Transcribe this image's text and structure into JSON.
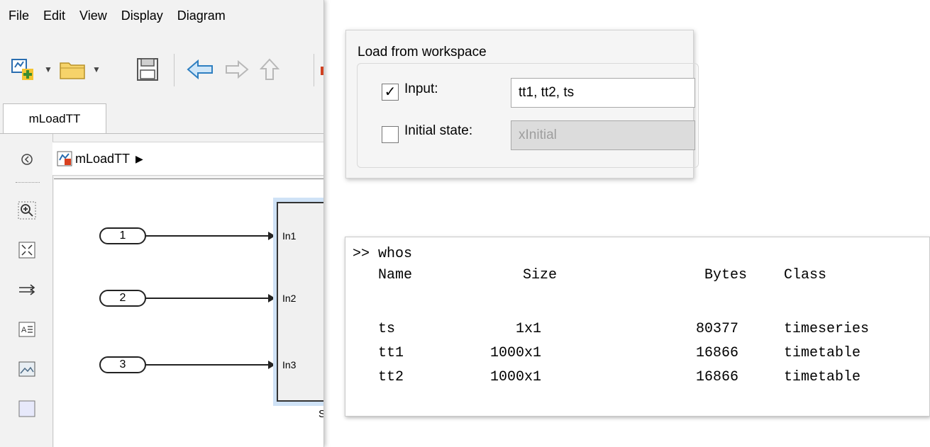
{
  "simulink": {
    "menu": [
      "File",
      "Edit",
      "View",
      "Display",
      "Diagram"
    ],
    "model_tab": "mLoadTT",
    "address": {
      "model_name": "mLoadTT",
      "arrow": "▶"
    },
    "ports": [
      "1",
      "2",
      "3"
    ],
    "subsystem": {
      "inputs": [
        "In1",
        "In2",
        "In3"
      ],
      "partial_label": "S"
    }
  },
  "load_from_workspace": {
    "title": "Load from workspace",
    "input": {
      "label": "Input:",
      "checked": true,
      "checkmark": "✓",
      "value": "tt1, tt2, ts"
    },
    "initial_state": {
      "label": "Initial state:",
      "checked": false,
      "value": "xInitial"
    }
  },
  "command_window": {
    "command": ">> whos",
    "headers": [
      "Name",
      "Size",
      "Bytes",
      "Class"
    ],
    "rows": [
      [
        "ts",
        "1x1",
        "80377",
        "timeseries"
      ],
      [
        "tt1",
        "1000x1",
        "16866",
        "timetable"
      ],
      [
        "tt2",
        "1000x1",
        "16866",
        "timetable"
      ]
    ]
  }
}
